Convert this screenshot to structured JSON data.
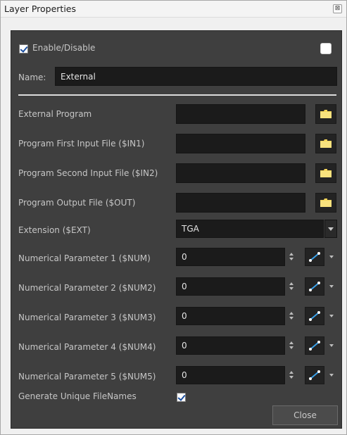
{
  "window": {
    "title": "Layer Properties",
    "close_glyph": "⊠"
  },
  "enable": {
    "label": "Enable/Disable",
    "checked": true
  },
  "name_field": {
    "label": "Name:",
    "value": "External"
  },
  "file_rows": [
    {
      "label": "External Program",
      "value": "",
      "icon": "folder-icon"
    },
    {
      "label": "Program First Input File ($IN1)",
      "value": "",
      "icon": "folder-icon"
    },
    {
      "label": "Program Second Input File ($IN2)",
      "value": "",
      "icon": "folder-icon"
    },
    {
      "label": "Program Output File ($OUT)",
      "value": "",
      "icon": "folder-icon"
    }
  ],
  "extension": {
    "label": "Extension ($EXT)",
    "value": "TGA"
  },
  "num_rows": [
    {
      "label": "Numerical Parameter 1 ($NUM)",
      "value": "0"
    },
    {
      "label": "Numerical Parameter 2 ($NUM2)",
      "value": "0"
    },
    {
      "label": "Numerical Parameter 3 ($NUM3)",
      "value": "0"
    },
    {
      "label": "Numerical Parameter 4 ($NUM4)",
      "value": "0"
    },
    {
      "label": "Numerical Parameter 5 ($NUM5)",
      "value": "0"
    }
  ],
  "generate_unique": {
    "label": "Generate Unique FileNames",
    "checked": true
  },
  "buttons": {
    "close": "Close"
  },
  "colors": {
    "panel_bg": "#3f3f3f",
    "field_bg": "#1b1b1b",
    "folder_yellow": "#f5d55a",
    "func_blue": "#3aa0e8"
  }
}
